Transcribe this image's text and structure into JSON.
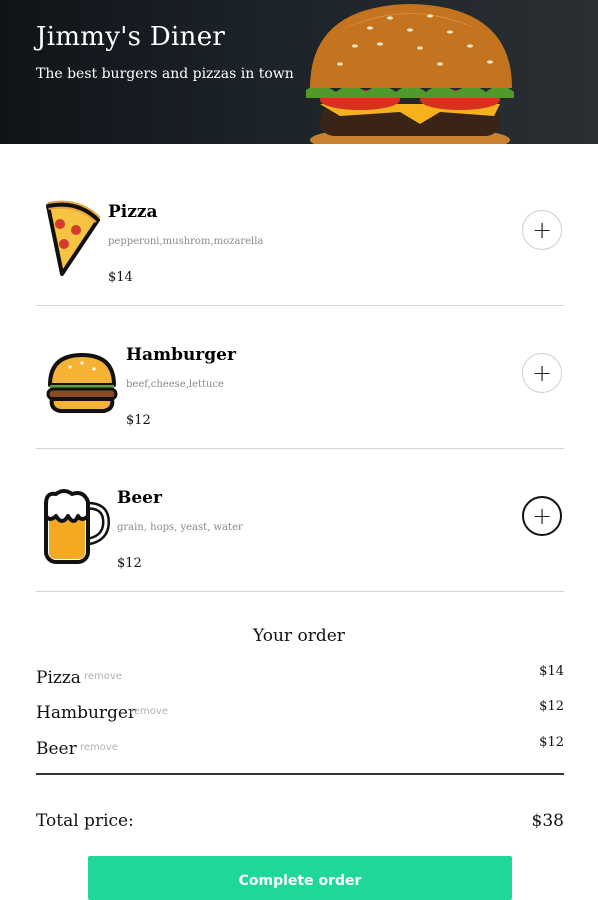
{
  "header": {
    "title": "Jimmy's Diner",
    "subtitle": "The best burgers and pizzas in town"
  },
  "menu": {
    "items": [
      {
        "name": "Pizza",
        "ingredients": "pepperoni,mushrom,mozarella",
        "price": "$14",
        "icon": "pizza-icon"
      },
      {
        "name": "Hamburger",
        "ingredients": "beef,cheese,lettuce",
        "price": "$12",
        "icon": "hamburger-icon"
      },
      {
        "name": "Beer",
        "ingredients": "grain, hops, yeast, water",
        "price": "$12",
        "icon": "beer-icon"
      }
    ],
    "add_symbol": "+"
  },
  "order": {
    "title": "Your order",
    "remove_label": "remove",
    "items": [
      {
        "name": "Pizza",
        "price": "$14"
      },
      {
        "name": "Hamburger",
        "price": "$12"
      },
      {
        "name": "Beer",
        "price": "$12"
      }
    ],
    "total_label": "Total price:",
    "total_value": "$38",
    "complete_label": "Complete order"
  },
  "colors": {
    "accent": "#1fd69b",
    "header_bg": "#1c2329"
  }
}
